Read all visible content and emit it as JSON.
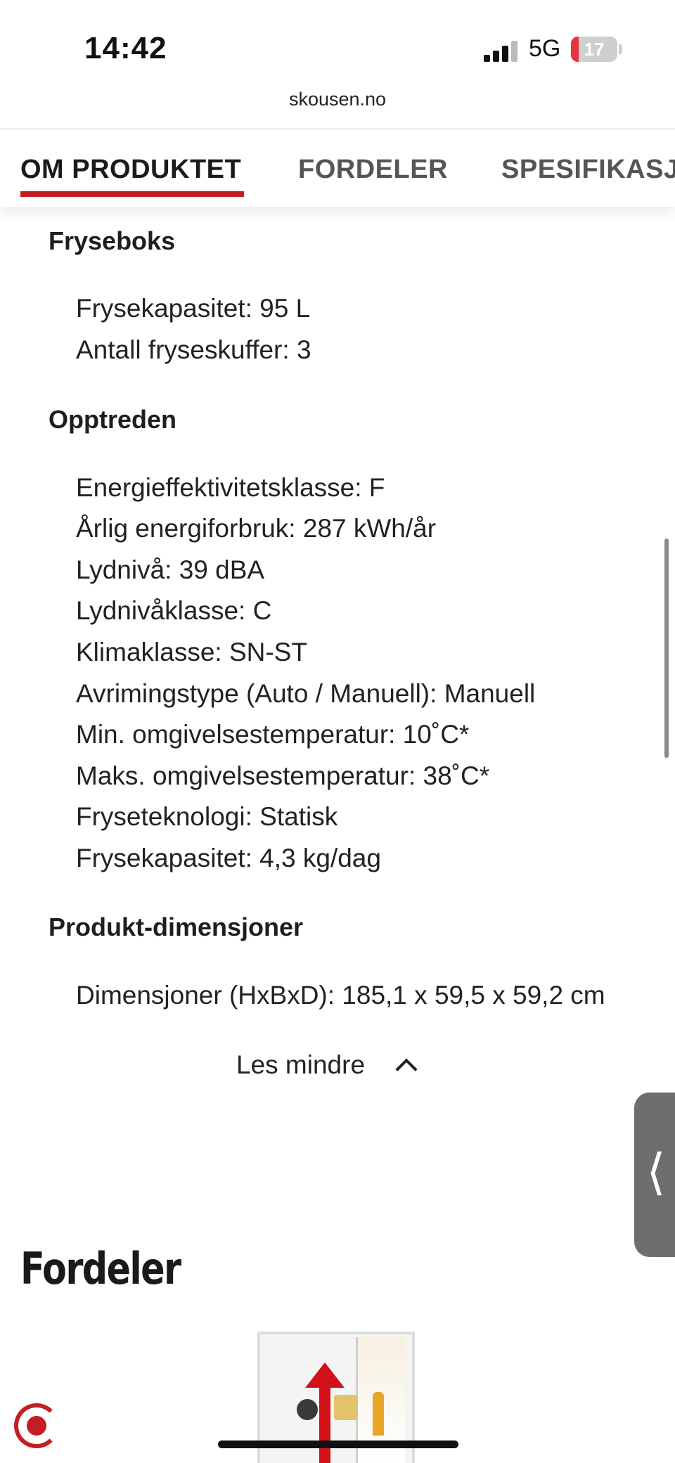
{
  "status_bar": {
    "time": "14:42",
    "network": "5G",
    "battery_level": "17",
    "battery_fraction": 0.17
  },
  "browser": {
    "url": "skousen.no"
  },
  "tabs": [
    {
      "label": "OM PRODUKTET",
      "active": true
    },
    {
      "label": "FORDELER",
      "active": false
    },
    {
      "label": "SPESIFIKASJ",
      "active": false
    }
  ],
  "sections": [
    {
      "heading": "Fryseboks",
      "items": [
        "Frysekapasitet: 95 L",
        "Antall fryseskuffer: 3"
      ]
    },
    {
      "heading": "Opptreden",
      "items": [
        "Energieffektivitetsklasse: F",
        "Årlig energiforbruk: 287 kWh/år",
        "Lydnivå: 39 dBA",
        "Lydnivåklasse: C",
        "Klimaklasse: SN-ST",
        "Avrimingstype (Auto / Manuell): Manuell",
        "Min. omgivelsestemperatur: 10˚C*",
        "Maks. omgivelsestemperatur: 38˚C*",
        "Fryseteknologi: Statisk",
        "Frysekapasitet: 4,3 kg/dag"
      ]
    },
    {
      "heading": "Produkt-dimensjoner",
      "items": [
        "Dimensjoner (HxBxD): 185,1 x 59,5 x 59,2 cm"
      ]
    }
  ],
  "read_less": {
    "label": "Les mindre"
  },
  "fordeler": {
    "title": "Fordeler"
  },
  "icons": {
    "chevron": "chevron-up-icon",
    "side_handle": "chevron-left-icon",
    "bottom": "recycle-icon"
  },
  "colors": {
    "accent": "#c41d23",
    "text": "#1c1c1c"
  }
}
